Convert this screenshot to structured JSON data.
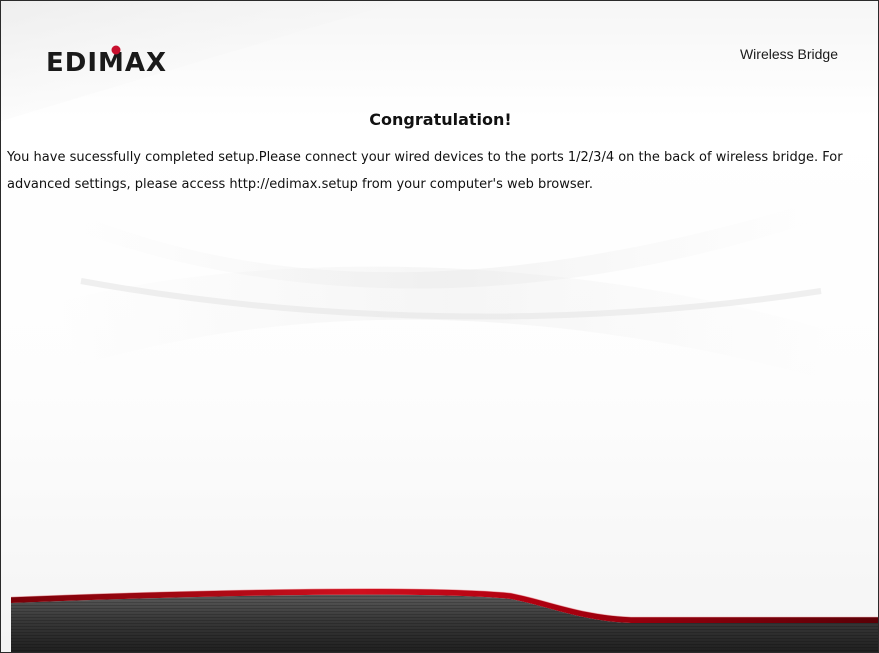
{
  "header": {
    "brand_logo": "EDIMAX",
    "product_name": "Wireless Bridge"
  },
  "main": {
    "title": "Congratulation!",
    "message": "You have sucessfully completed setup.Please connect your wired devices to the ports 1/2/3/4 on the back of wireless bridge. For advanced settings, please access http://edimax.setup from your computer's web browser."
  },
  "colors": {
    "logo": "#1a1a1a",
    "logo_accent": "#c8102e",
    "footer_dark": "#3a3a3a",
    "footer_red": "#b00010"
  }
}
